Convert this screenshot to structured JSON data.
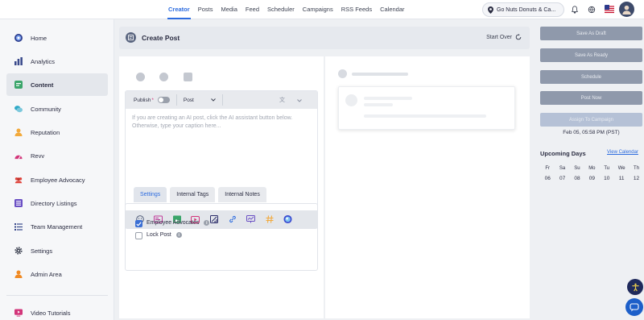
{
  "topnav": {
    "items": [
      "Creator",
      "Posts",
      "Media",
      "Feed",
      "Scheduler",
      "Campaigns",
      "RSS Feeds",
      "Calendar"
    ],
    "active": "Creator"
  },
  "location": {
    "label": "Go Nuts Donuts & Ca..."
  },
  "sidebar": {
    "items": [
      {
        "label": "Home",
        "icon": "home-logo-icon"
      },
      {
        "label": "Analytics",
        "icon": "bar-chart-icon"
      },
      {
        "label": "Content",
        "icon": "content-icon"
      },
      {
        "label": "Community",
        "icon": "community-icon"
      },
      {
        "label": "Reputation",
        "icon": "reputation-icon"
      },
      {
        "label": "Revv",
        "icon": "revv-icon"
      },
      {
        "label": "Employee Advocacy",
        "icon": "employee-advocacy-icon"
      },
      {
        "label": "Directory Listings",
        "icon": "directory-icon"
      },
      {
        "label": "Team Management",
        "icon": "team-icon"
      },
      {
        "label": "Settings",
        "icon": "gear-icon"
      },
      {
        "label": "Admin Area",
        "icon": "admin-icon"
      },
      {
        "label": "Video Tutorials",
        "icon": "video-icon"
      }
    ],
    "active": "Content"
  },
  "create_post": {
    "title": "Create Post",
    "start_over": "Start Over"
  },
  "composer": {
    "publish_label": "Publish",
    "publish_required": "*",
    "post_type": "Post",
    "placeholder": "If you are creating an AI post, click the AI assistant button below. Otherwise, type your caption here..."
  },
  "tabs": [
    "Settings",
    "Internal Tags",
    "Internal Notes"
  ],
  "settings": {
    "employee_advocates": {
      "label": "Employee Advocates",
      "checked": true
    },
    "lock_post": {
      "label": "Lock Post",
      "checked": false
    }
  },
  "actions": {
    "save_draft": "Save As Draft",
    "save_ready": "Save As Ready",
    "schedule": "Schedule",
    "post_now": "Post Now",
    "assign_campaign": "Assign To Campaign"
  },
  "schedule_time": "Feb 05, 05:58 PM (PST)",
  "upcoming": {
    "title": "Upcoming Days",
    "view_calendar": "View Calendar",
    "weekdays": [
      "Fr",
      "Sa",
      "Su",
      "Mo",
      "Tu",
      "We",
      "Th"
    ],
    "dates": [
      "06",
      "07",
      "08",
      "09",
      "10",
      "11",
      "12"
    ]
  },
  "colors": {
    "accent": "#2d6cdf",
    "button": "#8f99ab",
    "button_light": "#b5c1d6"
  }
}
